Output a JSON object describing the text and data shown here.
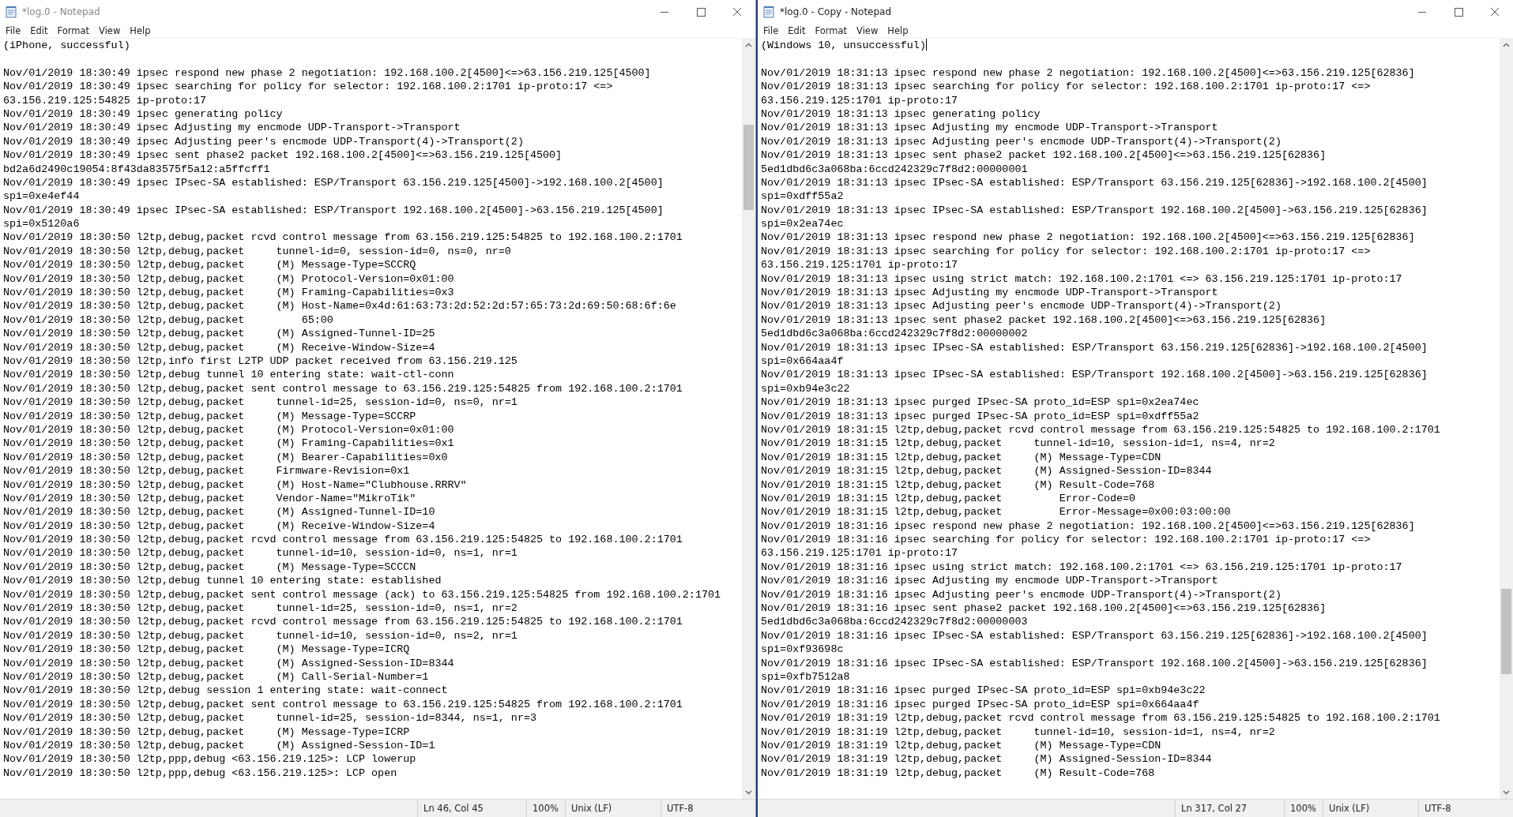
{
  "windows": [
    {
      "title": "*log.0 - Notepad",
      "active": false,
      "menu": [
        "File",
        "Edit",
        "Format",
        "View",
        "Help"
      ],
      "header": "(iPhone, successful)",
      "cursor": false,
      "lines": [
        "Nov/01/2019 18:30:49 ipsec respond new phase 2 negotiation: 192.168.100.2[4500]<=>63.156.219.125[4500]",
        "Nov/01/2019 18:30:49 ipsec searching for policy for selector: 192.168.100.2:1701 ip-proto:17 <=>",
        "63.156.219.125:54825 ip-proto:17",
        "Nov/01/2019 18:30:49 ipsec generating policy",
        "Nov/01/2019 18:30:49 ipsec Adjusting my encmode UDP-Transport->Transport",
        "Nov/01/2019 18:30:49 ipsec Adjusting peer's encmode UDP-Transport(4)->Transport(2)",
        "Nov/01/2019 18:30:49 ipsec sent phase2 packet 192.168.100.2[4500]<=>63.156.219.125[4500]",
        "bd2a6d2490c19054:8f43da83575f5a12:a5ffcff1",
        "Nov/01/2019 18:30:49 ipsec IPsec-SA established: ESP/Transport 63.156.219.125[4500]->192.168.100.2[4500]",
        "spi=0xe4ef44",
        "Nov/01/2019 18:30:49 ipsec IPsec-SA established: ESP/Transport 192.168.100.2[4500]->63.156.219.125[4500]",
        "spi=0x5120a6",
        "Nov/01/2019 18:30:50 l2tp,debug,packet rcvd control message from 63.156.219.125:54825 to 192.168.100.2:1701",
        "Nov/01/2019 18:30:50 l2tp,debug,packet     tunnel-id=0, session-id=0, ns=0, nr=0",
        "Nov/01/2019 18:30:50 l2tp,debug,packet     (M) Message-Type=SCCRQ",
        "Nov/01/2019 18:30:50 l2tp,debug,packet     (M) Protocol-Version=0x01:00",
        "Nov/01/2019 18:30:50 l2tp,debug,packet     (M) Framing-Capabilities=0x3",
        "Nov/01/2019 18:30:50 l2tp,debug,packet     (M) Host-Name=0x4d:61:63:73:2d:52:2d:57:65:73:2d:69:50:68:6f:6e",
        "Nov/01/2019 18:30:50 l2tp,debug,packet         65:00",
        "Nov/01/2019 18:30:50 l2tp,debug,packet     (M) Assigned-Tunnel-ID=25",
        "Nov/01/2019 18:30:50 l2tp,debug,packet     (M) Receive-Window-Size=4",
        "Nov/01/2019 18:30:50 l2tp,info first L2TP UDP packet received from 63.156.219.125",
        "Nov/01/2019 18:30:50 l2tp,debug tunnel 10 entering state: wait-ctl-conn",
        "Nov/01/2019 18:30:50 l2tp,debug,packet sent control message to 63.156.219.125:54825 from 192.168.100.2:1701",
        "Nov/01/2019 18:30:50 l2tp,debug,packet     tunnel-id=25, session-id=0, ns=0, nr=1",
        "Nov/01/2019 18:30:50 l2tp,debug,packet     (M) Message-Type=SCCRP",
        "Nov/01/2019 18:30:50 l2tp,debug,packet     (M) Protocol-Version=0x01:00",
        "Nov/01/2019 18:30:50 l2tp,debug,packet     (M) Framing-Capabilities=0x1",
        "Nov/01/2019 18:30:50 l2tp,debug,packet     (M) Bearer-Capabilities=0x0",
        "Nov/01/2019 18:30:50 l2tp,debug,packet     Firmware-Revision=0x1",
        "Nov/01/2019 18:30:50 l2tp,debug,packet     (M) Host-Name=\"Clubhouse.RRRV\"",
        "Nov/01/2019 18:30:50 l2tp,debug,packet     Vendor-Name=\"MikroTik\"",
        "Nov/01/2019 18:30:50 l2tp,debug,packet     (M) Assigned-Tunnel-ID=10",
        "Nov/01/2019 18:30:50 l2tp,debug,packet     (M) Receive-Window-Size=4",
        "Nov/01/2019 18:30:50 l2tp,debug,packet rcvd control message from 63.156.219.125:54825 to 192.168.100.2:1701",
        "Nov/01/2019 18:30:50 l2tp,debug,packet     tunnel-id=10, session-id=0, ns=1, nr=1",
        "Nov/01/2019 18:30:50 l2tp,debug,packet     (M) Message-Type=SCCCN",
        "Nov/01/2019 18:30:50 l2tp,debug tunnel 10 entering state: established",
        "Nov/01/2019 18:30:50 l2tp,debug,packet sent control message (ack) to 63.156.219.125:54825 from 192.168.100.2:1701",
        "Nov/01/2019 18:30:50 l2tp,debug,packet     tunnel-id=25, session-id=0, ns=1, nr=2",
        "Nov/01/2019 18:30:50 l2tp,debug,packet rcvd control message from 63.156.219.125:54825 to 192.168.100.2:1701",
        "Nov/01/2019 18:30:50 l2tp,debug,packet     tunnel-id=10, session-id=0, ns=2, nr=1",
        "Nov/01/2019 18:30:50 l2tp,debug,packet     (M) Message-Type=ICRQ",
        "Nov/01/2019 18:30:50 l2tp,debug,packet     (M) Assigned-Session-ID=8344",
        "Nov/01/2019 18:30:50 l2tp,debug,packet     (M) Call-Serial-Number=1",
        "Nov/01/2019 18:30:50 l2tp,debug session 1 entering state: wait-connect",
        "Nov/01/2019 18:30:50 l2tp,debug,packet sent control message to 63.156.219.125:54825 from 192.168.100.2:1701",
        "Nov/01/2019 18:30:50 l2tp,debug,packet     tunnel-id=25, session-id=8344, ns=1, nr=3",
        "Nov/01/2019 18:30:50 l2tp,debug,packet     (M) Message-Type=ICRP",
        "Nov/01/2019 18:30:50 l2tp,debug,packet     (M) Assigned-Session-ID=1",
        "Nov/01/2019 18:30:50 l2tp,ppp,debug <63.156.219.125>: LCP lowerup",
        "Nov/01/2019 18:30:50 l2tp,ppp,debug <63.156.219.125>: LCP open"
      ],
      "status": {
        "position": "Ln 46, Col 45",
        "zoom": "100%",
        "line_ending": "Unix (LF)",
        "encoding": "UTF-8"
      }
    },
    {
      "title": "*log.0 - Copy - Notepad",
      "active": true,
      "menu": [
        "File",
        "Edit",
        "Format",
        "View",
        "Help"
      ],
      "header": "(Windows 10, unsuccessful)",
      "cursor": true,
      "lines": [
        "Nov/01/2019 18:31:13 ipsec respond new phase 2 negotiation: 192.168.100.2[4500]<=>63.156.219.125[62836]",
        "Nov/01/2019 18:31:13 ipsec searching for policy for selector: 192.168.100.2:1701 ip-proto:17 <=>",
        "63.156.219.125:1701 ip-proto:17",
        "Nov/01/2019 18:31:13 ipsec generating policy",
        "Nov/01/2019 18:31:13 ipsec Adjusting my encmode UDP-Transport->Transport",
        "Nov/01/2019 18:31:13 ipsec Adjusting peer's encmode UDP-Transport(4)->Transport(2)",
        "Nov/01/2019 18:31:13 ipsec sent phase2 packet 192.168.100.2[4500]<=>63.156.219.125[62836]",
        "5ed1dbd6c3a068ba:6ccd242329c7f8d2:00000001",
        "Nov/01/2019 18:31:13 ipsec IPsec-SA established: ESP/Transport 63.156.219.125[62836]->192.168.100.2[4500]",
        "spi=0xdff55a2",
        "Nov/01/2019 18:31:13 ipsec IPsec-SA established: ESP/Transport 192.168.100.2[4500]->63.156.219.125[62836]",
        "spi=0x2ea74ec",
        "Nov/01/2019 18:31:13 ipsec respond new phase 2 negotiation: 192.168.100.2[4500]<=>63.156.219.125[62836]",
        "Nov/01/2019 18:31:13 ipsec searching for policy for selector: 192.168.100.2:1701 ip-proto:17 <=>",
        "63.156.219.125:1701 ip-proto:17",
        "Nov/01/2019 18:31:13 ipsec using strict match: 192.168.100.2:1701 <=> 63.156.219.125:1701 ip-proto:17",
        "Nov/01/2019 18:31:13 ipsec Adjusting my encmode UDP-Transport->Transport",
        "Nov/01/2019 18:31:13 ipsec Adjusting peer's encmode UDP-Transport(4)->Transport(2)",
        "Nov/01/2019 18:31:13 ipsec sent phase2 packet 192.168.100.2[4500]<=>63.156.219.125[62836]",
        "5ed1dbd6c3a068ba:6ccd242329c7f8d2:00000002",
        "Nov/01/2019 18:31:13 ipsec IPsec-SA established: ESP/Transport 63.156.219.125[62836]->192.168.100.2[4500]",
        "spi=0x664aa4f",
        "Nov/01/2019 18:31:13 ipsec IPsec-SA established: ESP/Transport 192.168.100.2[4500]->63.156.219.125[62836]",
        "spi=0xb94e3c22",
        "Nov/01/2019 18:31:13 ipsec purged IPsec-SA proto_id=ESP spi=0x2ea74ec",
        "Nov/01/2019 18:31:13 ipsec purged IPsec-SA proto_id=ESP spi=0xdff55a2",
        "Nov/01/2019 18:31:15 l2tp,debug,packet rcvd control message from 63.156.219.125:54825 to 192.168.100.2:1701",
        "Nov/01/2019 18:31:15 l2tp,debug,packet     tunnel-id=10, session-id=1, ns=4, nr=2",
        "Nov/01/2019 18:31:15 l2tp,debug,packet     (M) Message-Type=CDN",
        "Nov/01/2019 18:31:15 l2tp,debug,packet     (M) Assigned-Session-ID=8344",
        "Nov/01/2019 18:31:15 l2tp,debug,packet     (M) Result-Code=768",
        "Nov/01/2019 18:31:15 l2tp,debug,packet         Error-Code=0",
        "Nov/01/2019 18:31:15 l2tp,debug,packet         Error-Message=0x00:03:00:00",
        "Nov/01/2019 18:31:16 ipsec respond new phase 2 negotiation: 192.168.100.2[4500]<=>63.156.219.125[62836]",
        "Nov/01/2019 18:31:16 ipsec searching for policy for selector: 192.168.100.2:1701 ip-proto:17 <=>",
        "63.156.219.125:1701 ip-proto:17",
        "Nov/01/2019 18:31:16 ipsec using strict match: 192.168.100.2:1701 <=> 63.156.219.125:1701 ip-proto:17",
        "Nov/01/2019 18:31:16 ipsec Adjusting my encmode UDP-Transport->Transport",
        "Nov/01/2019 18:31:16 ipsec Adjusting peer's encmode UDP-Transport(4)->Transport(2)",
        "Nov/01/2019 18:31:16 ipsec sent phase2 packet 192.168.100.2[4500]<=>63.156.219.125[62836]",
        "5ed1dbd6c3a068ba:6ccd242329c7f8d2:00000003",
        "Nov/01/2019 18:31:16 ipsec IPsec-SA established: ESP/Transport 63.156.219.125[62836]->192.168.100.2[4500]",
        "spi=0xf93698c",
        "Nov/01/2019 18:31:16 ipsec IPsec-SA established: ESP/Transport 192.168.100.2[4500]->63.156.219.125[62836]",
        "spi=0xfb7512a8",
        "Nov/01/2019 18:31:16 ipsec purged IPsec-SA proto_id=ESP spi=0xb94e3c22",
        "Nov/01/2019 18:31:16 ipsec purged IPsec-SA proto_id=ESP spi=0x664aa4f",
        "Nov/01/2019 18:31:19 l2tp,debug,packet rcvd control message from 63.156.219.125:54825 to 192.168.100.2:1701",
        "Nov/01/2019 18:31:19 l2tp,debug,packet     tunnel-id=10, session-id=1, ns=4, nr=2",
        "Nov/01/2019 18:31:19 l2tp,debug,packet     (M) Message-Type=CDN",
        "Nov/01/2019 18:31:19 l2tp,debug,packet     (M) Assigned-Session-ID=8344",
        "Nov/01/2019 18:31:19 l2tp,debug,packet     (M) Result-Code=768"
      ],
      "status": {
        "position": "Ln 317, Col 27",
        "zoom": "100%",
        "line_ending": "Unix (LF)",
        "encoding": "UTF-8"
      }
    }
  ]
}
